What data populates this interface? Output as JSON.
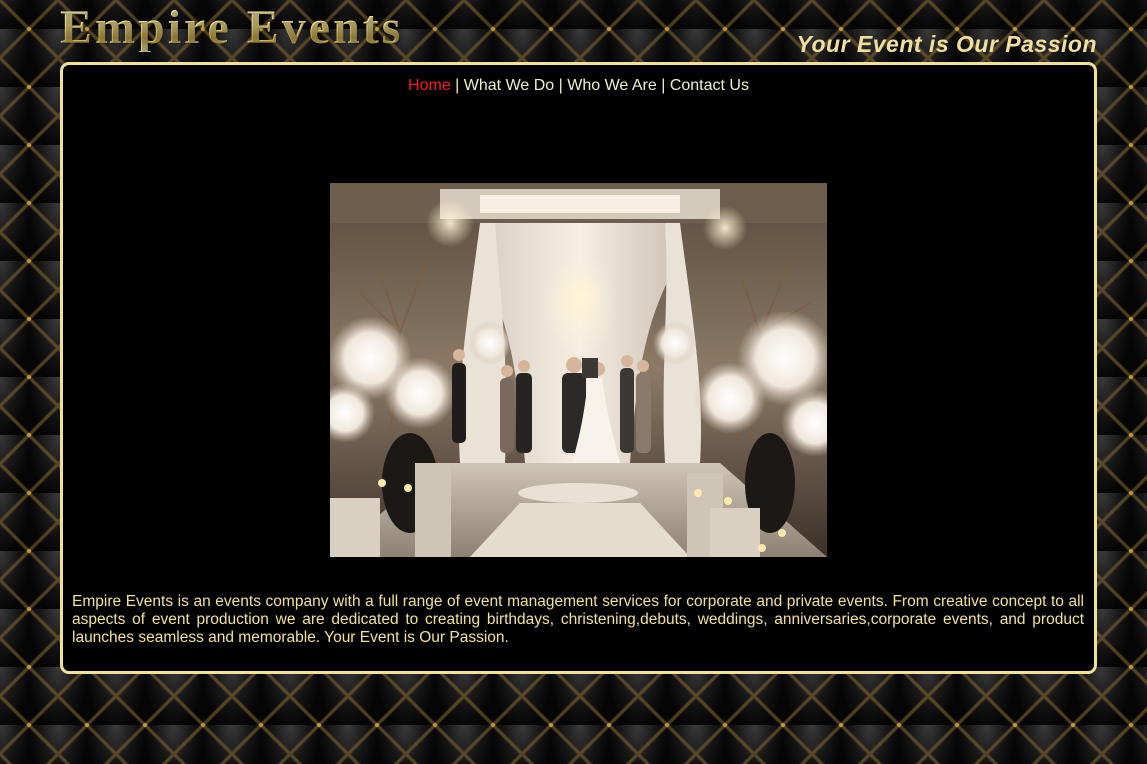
{
  "header": {
    "site_title": "Empire Events",
    "tagline": "Your Event is Our Passion"
  },
  "nav": {
    "items": [
      {
        "label": "Home",
        "active": true
      },
      {
        "label": "What We Do",
        "active": false
      },
      {
        "label": "Who We Are",
        "active": false
      },
      {
        "label": "Contact Us",
        "active": false
      }
    ],
    "separator": "|"
  },
  "hero": {
    "icon": "wedding-ceremony-photo"
  },
  "about": {
    "text": "Empire Events is an events company with a full range of event management services for corporate and private events. From creative concept to all aspects of event production we are dedicated to creating birthdays, christening,debuts, weddings, anniversaries,corporate events, and product launches seamless and memorable. Your Event is Our Passion."
  },
  "colors": {
    "gold": "#efe197",
    "active_link": "#ff1a1a",
    "panel_bg": "#000000"
  }
}
